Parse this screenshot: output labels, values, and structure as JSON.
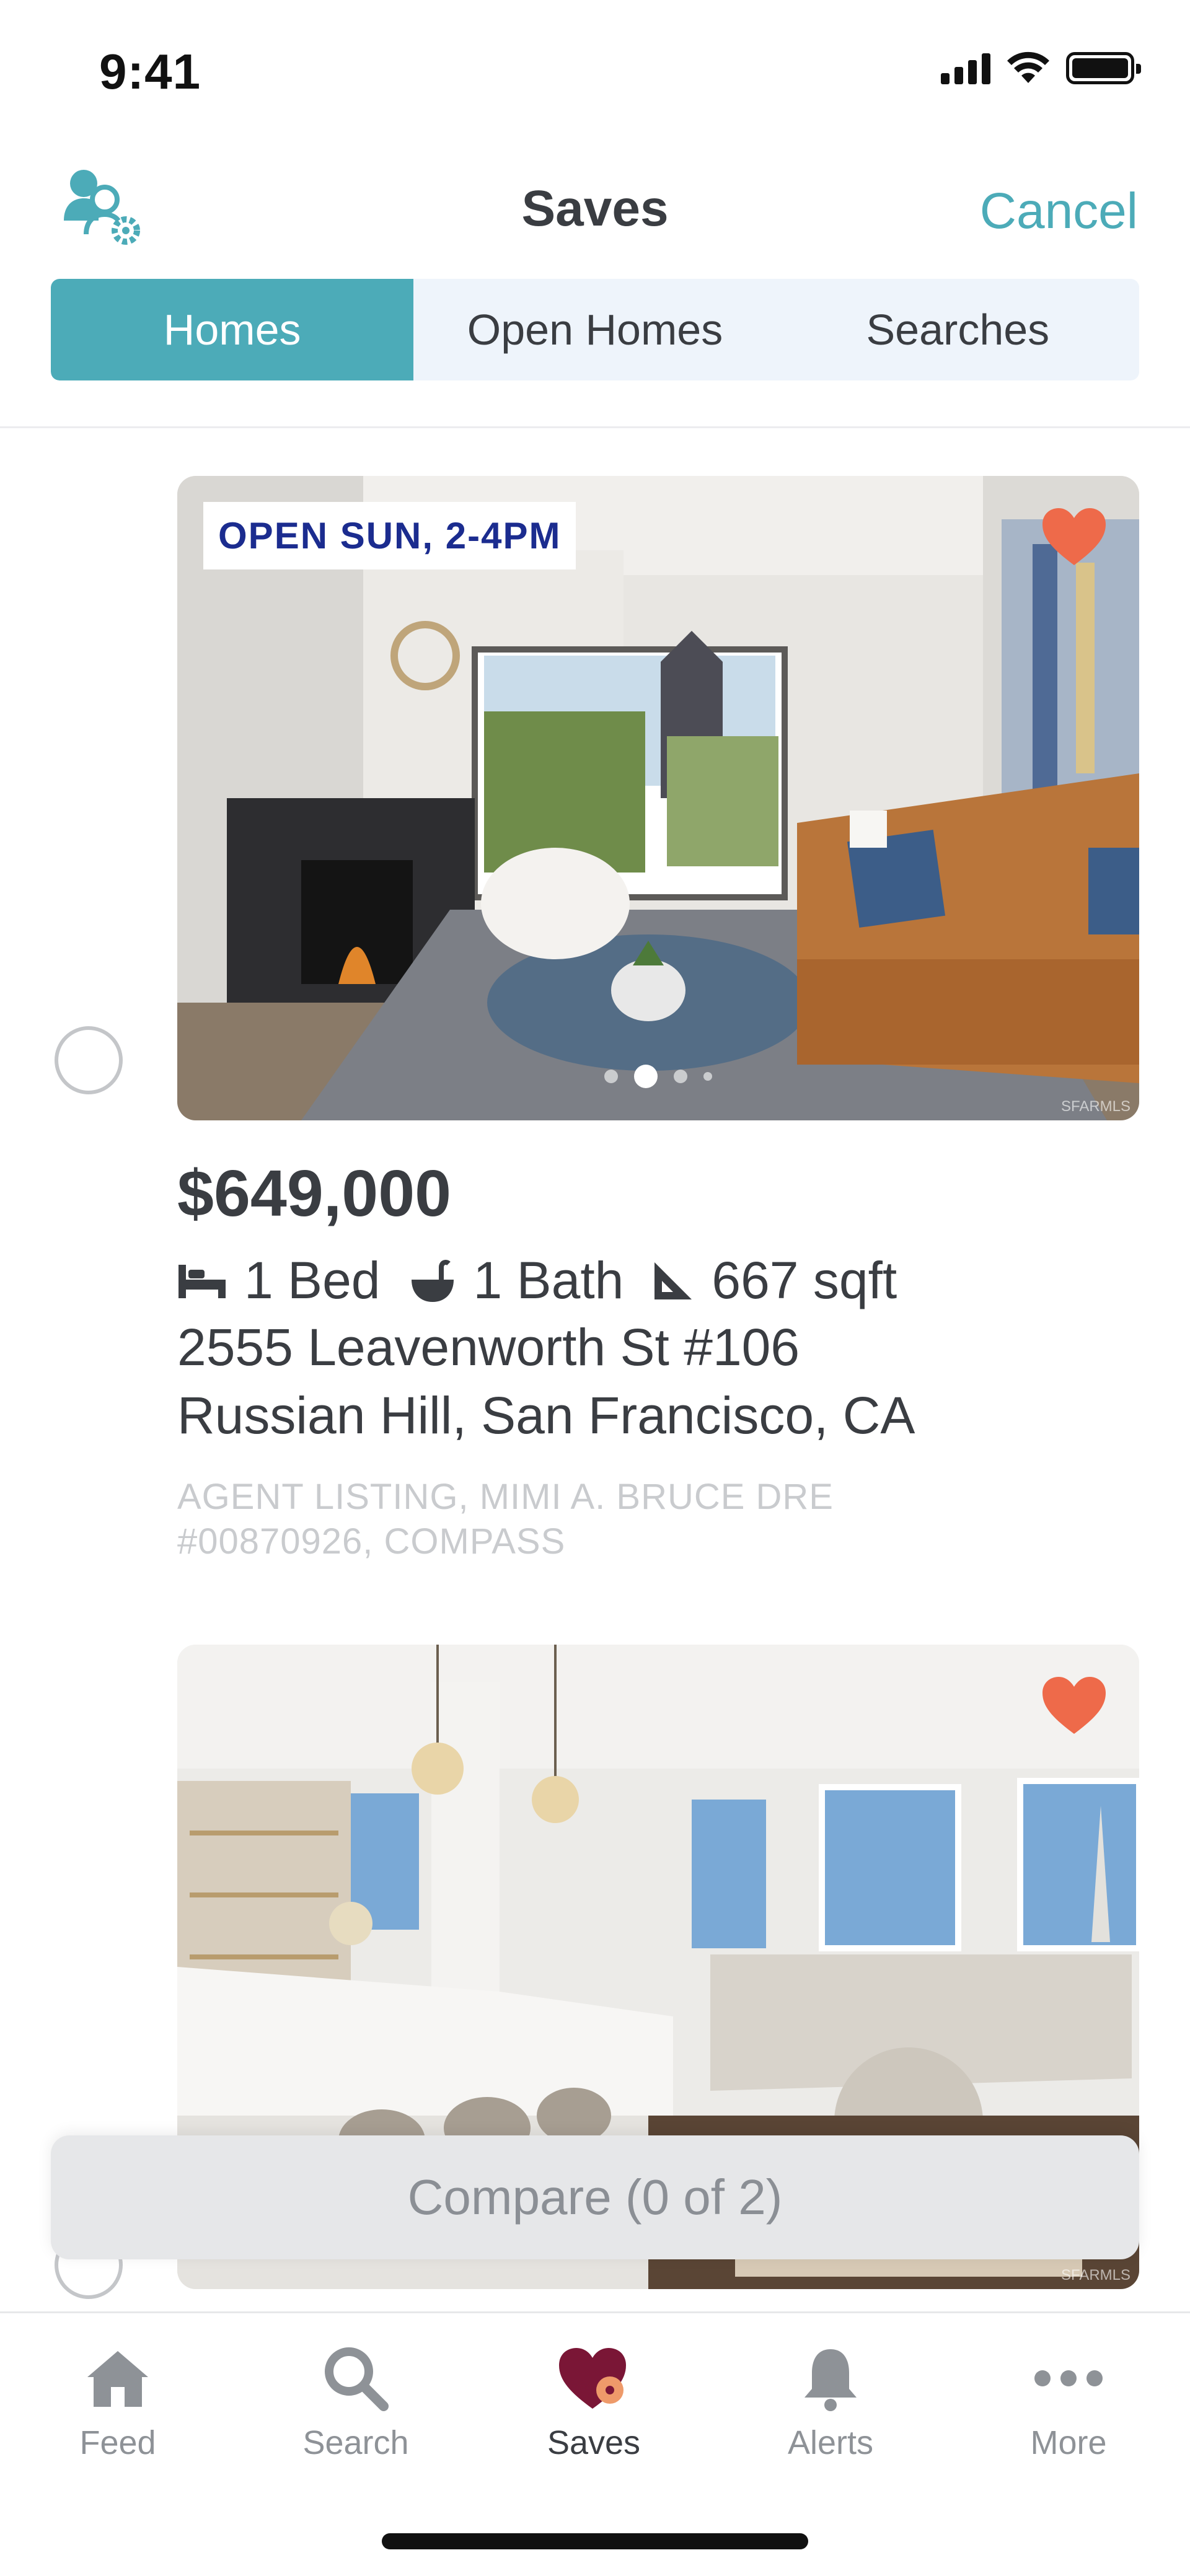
{
  "status_bar": {
    "time": "9:41"
  },
  "header": {
    "title": "Saves",
    "cancel_label": "Cancel"
  },
  "segments": [
    {
      "label": "Homes",
      "active": true
    },
    {
      "label": "Open Homes",
      "active": false
    },
    {
      "label": "Searches",
      "active": false
    }
  ],
  "listings": [
    {
      "badge": "OPEN SUN, 2-4PM",
      "saved": true,
      "photo_index": 2,
      "photo_count": 4,
      "watermark": "SFARMLS",
      "price": "$649,000",
      "beds": "1 Bed",
      "baths": "1 Bath",
      "sqft": "667 sqft",
      "address_line1": "2555 Leavenworth St #106",
      "address_line2": "Russian Hill, San Francisco, CA",
      "agent": "AGENT LISTING, MIMI A. BRUCE DRE #00870926, COMPASS"
    },
    {
      "saved": true,
      "watermark": "SFARMLS"
    }
  ],
  "compare": {
    "label": "Compare (0 of 2)"
  },
  "tab_bar": {
    "tabs": [
      {
        "label": "Feed",
        "icon": "house-icon"
      },
      {
        "label": "Search",
        "icon": "magnifier-icon"
      },
      {
        "label": "Saves",
        "icon": "heart-icon",
        "active": true
      },
      {
        "label": "Alerts",
        "icon": "bell-icon"
      },
      {
        "label": "More",
        "icon": "ellipsis-icon"
      }
    ]
  },
  "colors": {
    "accent": "#4cabb8",
    "heart": "#ee6a4a",
    "badge_text": "#1b2c8f",
    "saves_icon": "#7a1636",
    "segment_bg": "#eef4fb"
  }
}
